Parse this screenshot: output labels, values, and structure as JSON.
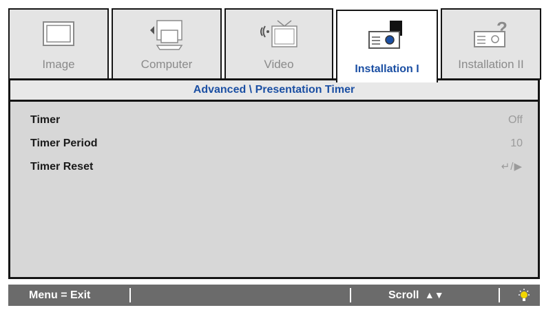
{
  "tabs": [
    {
      "label": "Image",
      "icon": "monitor-icon",
      "active": false
    },
    {
      "label": "Computer",
      "icon": "computer-icon",
      "active": false
    },
    {
      "label": "Video",
      "icon": "video-icon",
      "active": false
    },
    {
      "label": "Installation I",
      "icon": "projector-icon",
      "active": true
    },
    {
      "label": "Installation II",
      "icon": "projector-help-icon",
      "active": false
    }
  ],
  "breadcrumb": "Advanced \\ Presentation Timer",
  "settings": [
    {
      "label": "Timer",
      "value": "Off"
    },
    {
      "label": "Timer Period",
      "value": "10"
    },
    {
      "label": "Timer Reset",
      "value": "↵/▶"
    }
  ],
  "footer": {
    "menu_hint": "Menu = Exit",
    "scroll_hint": "Scroll",
    "scroll_icon": "▲▼",
    "lamp_icon": "lamp-icon"
  },
  "colors": {
    "accent": "#1b4fa3",
    "body_bg": "#d7d7d7",
    "footer_bg": "#6b6b6b",
    "muted": "#8a8a8a"
  }
}
